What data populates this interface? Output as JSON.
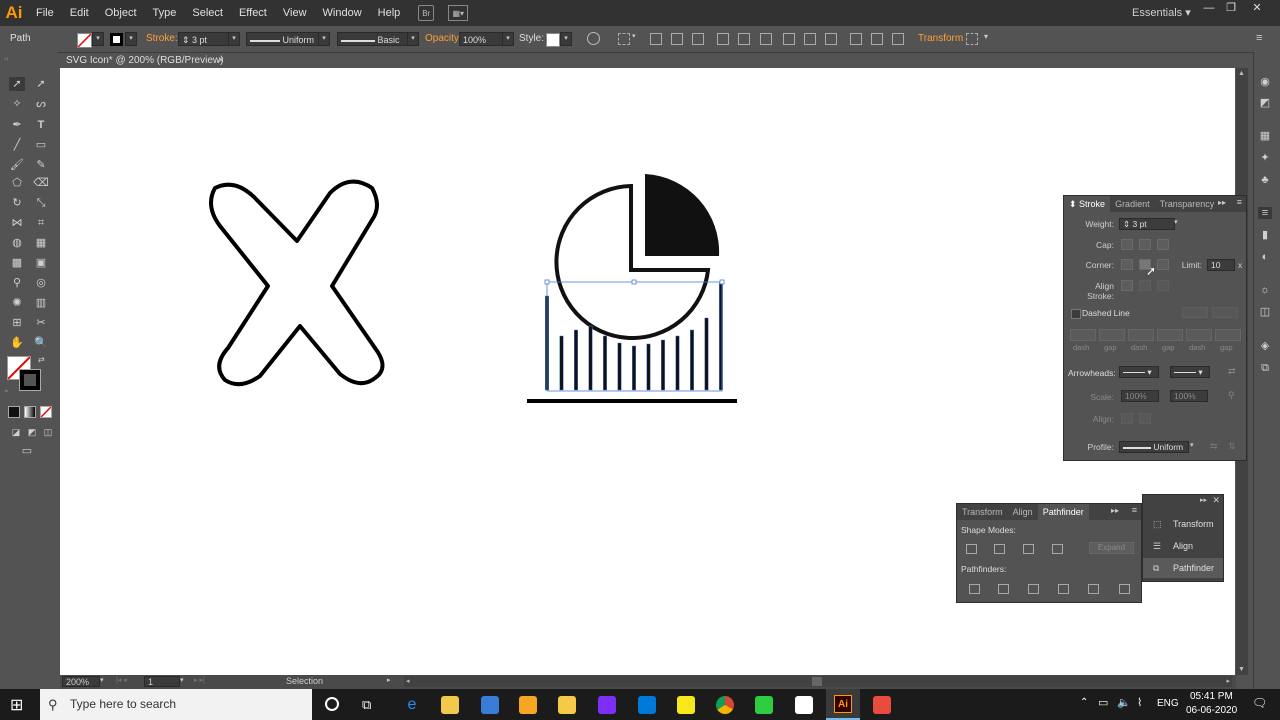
{
  "app": {
    "logo": "Ai",
    "workspace": "Essentials"
  },
  "menu": [
    "File",
    "Edit",
    "Object",
    "Type",
    "Select",
    "Effect",
    "View",
    "Window",
    "Help"
  ],
  "bridge_label": "Br",
  "control_bar": {
    "selection_type": "Path",
    "stroke_label": "Stroke:",
    "stroke_weight": "3 pt",
    "variable_width": "Uniform",
    "brush": "Basic",
    "opacity_label": "Opacity:",
    "opacity_value": "100%",
    "style_label": "Style:",
    "transform_label": "Transform"
  },
  "document": {
    "tab_title": "SVG Icon* @ 200% (RGB/Preview)",
    "close": "×"
  },
  "status_bar": {
    "zoom": "200%",
    "artboard": "1",
    "tool": "Selection"
  },
  "stroke_panel": {
    "tabs": [
      "Stroke",
      "Gradient",
      "Transparency"
    ],
    "weight_label": "Weight:",
    "weight_value": "3 pt",
    "cap_label": "Cap:",
    "corner_label": "Corner:",
    "limit_label": "Limit:",
    "limit_value": "10",
    "limit_unit": "x",
    "align_stroke_label": "Align Stroke:",
    "dashed_line_label": "Dashed Line",
    "dash_labels": [
      "dash",
      "gap",
      "dash",
      "gap",
      "dash",
      "gap"
    ],
    "arrowheads_label": "Arrowheads:",
    "scale_label": "Scale:",
    "scale_value_1": "100%",
    "scale_value_2": "100%",
    "align_label": "Align:",
    "profile_label": "Profile:",
    "profile_value": "Uniform"
  },
  "pathfinder_panel": {
    "tabs": [
      "Transform",
      "Align",
      "Pathfinder"
    ],
    "shape_modes_label": "Shape Modes:",
    "expand_label": "Expand",
    "pathfinders_label": "Pathfinders:"
  },
  "collapsed_panels": [
    "Transform",
    "Align",
    "Pathfinder"
  ],
  "taskbar": {
    "search_placeholder": "Type here to search",
    "language": "ENG",
    "time": "05:41 PM",
    "date": "06-06-2020"
  },
  "colors": {
    "ui_dark": "#323232",
    "ui_mid": "#535353",
    "accent_orange": "#ff9a00",
    "selection_blue": "#4a7bd6"
  }
}
